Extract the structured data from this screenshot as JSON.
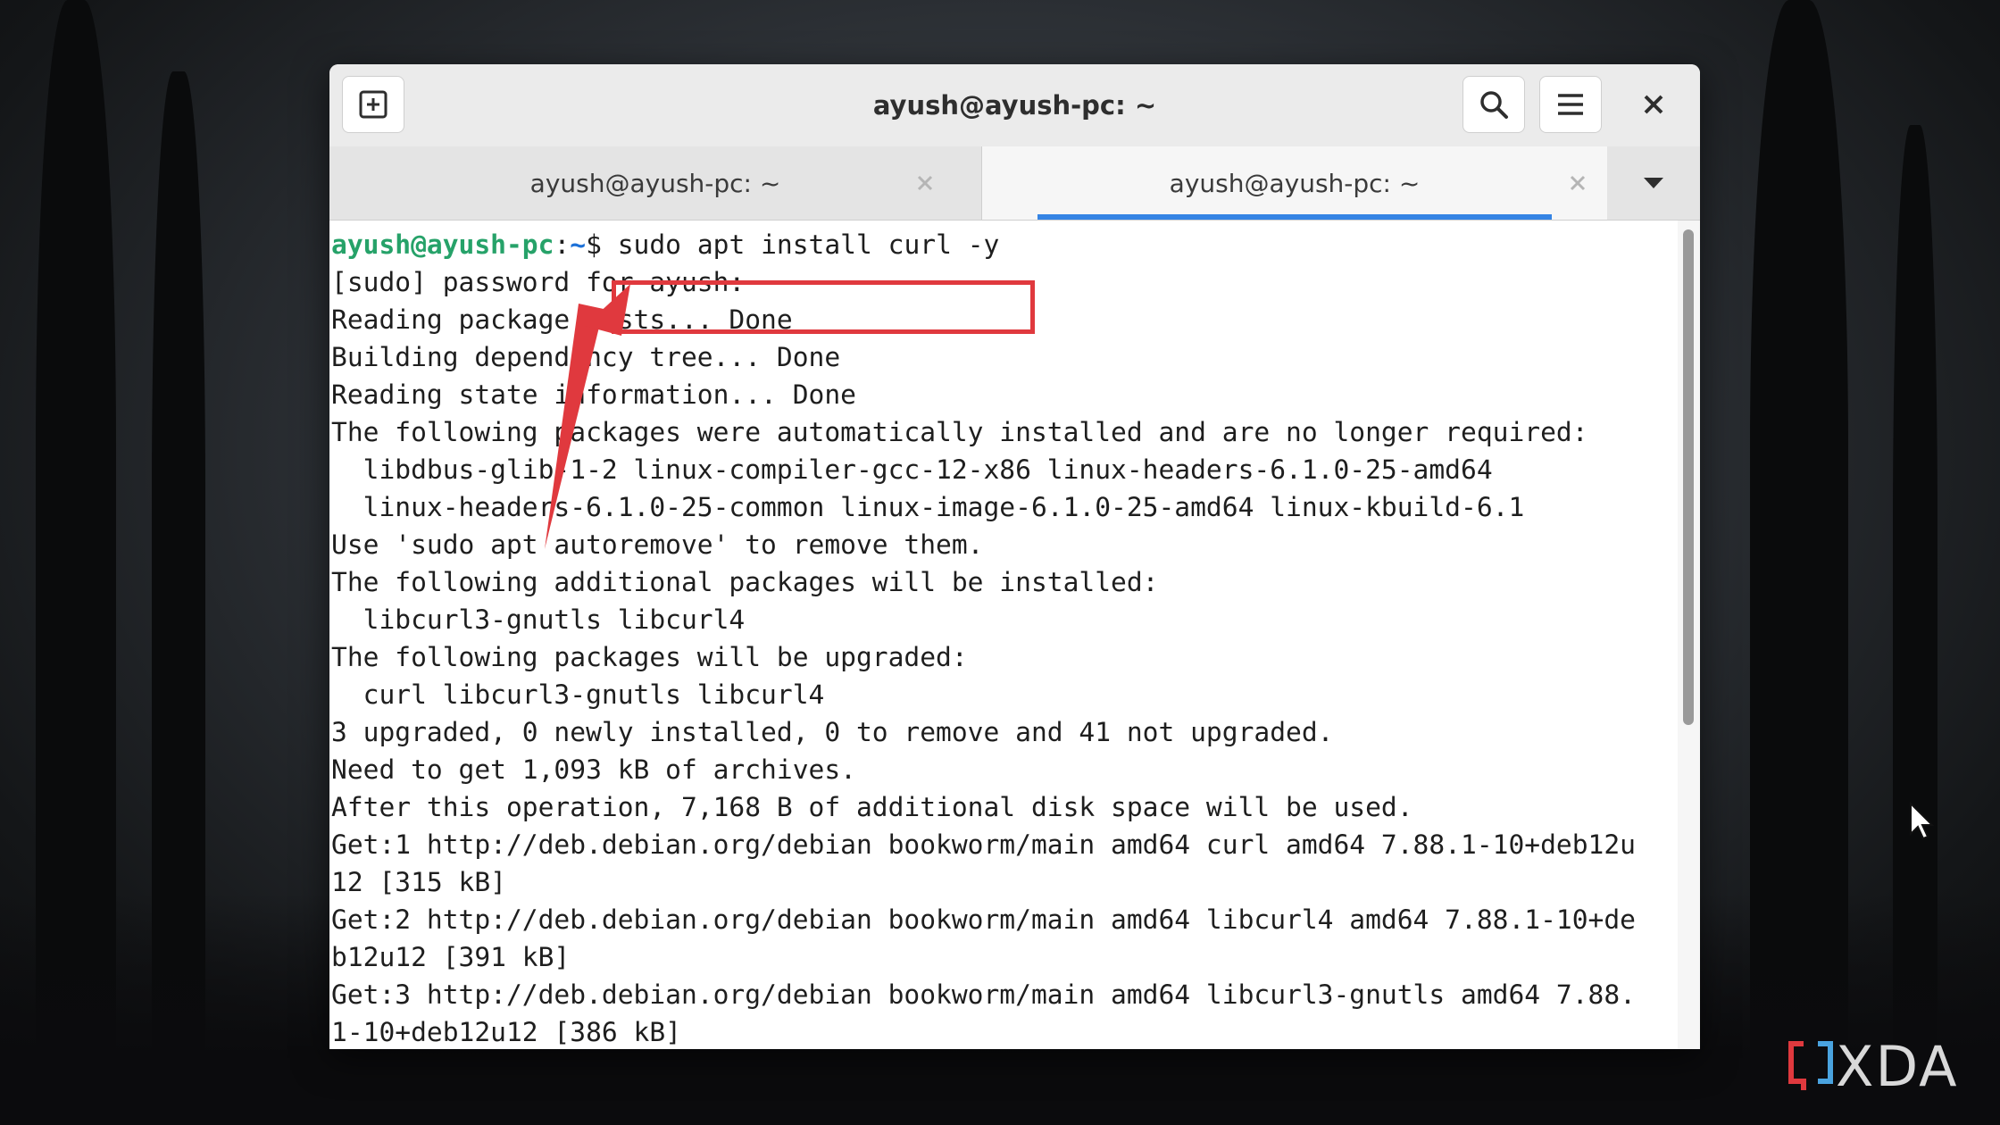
{
  "window": {
    "title": "ayush@ayush-pc: ~"
  },
  "tabs": [
    {
      "label": "ayush@ayush-pc: ~",
      "active": false
    },
    {
      "label": "ayush@ayush-pc: ~",
      "active": true
    }
  ],
  "terminal": {
    "prompt_user": "ayush@ayush-pc",
    "prompt_sep": ":",
    "prompt_path": "~",
    "prompt_symbol": "$ ",
    "command": "sudo apt install curl -y",
    "lines": [
      "[sudo] password for ayush:",
      "Reading package lists... Done",
      "Building dependency tree... Done",
      "Reading state information... Done",
      "The following packages were automatically installed and are no longer required:",
      "  libdbus-glib-1-2 linux-compiler-gcc-12-x86 linux-headers-6.1.0-25-amd64",
      "  linux-headers-6.1.0-25-common linux-image-6.1.0-25-amd64 linux-kbuild-6.1",
      "Use 'sudo apt autoremove' to remove them.",
      "The following additional packages will be installed:",
      "  libcurl3-gnutls libcurl4",
      "The following packages will be upgraded:",
      "  curl libcurl3-gnutls libcurl4",
      "3 upgraded, 0 newly installed, 0 to remove and 41 not upgraded.",
      "Need to get 1,093 kB of archives.",
      "After this operation, 7,168 B of additional disk space will be used.",
      "Get:1 http://deb.debian.org/debian bookworm/main amd64 curl amd64 7.88.1-10+deb12u",
      "12 [315 kB]",
      "Get:2 http://deb.debian.org/debian bookworm/main amd64 libcurl4 amd64 7.88.1-10+de",
      "b12u12 [391 kB]",
      "Get:3 http://deb.debian.org/debian bookworm/main amd64 libcurl3-gnutls amd64 7.88.",
      "1-10+deb12u12 [386 kB]"
    ]
  },
  "icons": {
    "new_tab": "new-tab-icon",
    "search": "search-icon",
    "menu": "hamburger-menu-icon",
    "close": "close-icon",
    "dropdown": "chevron-down-icon"
  },
  "colors": {
    "prompt_user": "#26a269",
    "prompt_path": "#1c71d8",
    "tab_indicator": "#3584e4",
    "annotation_red": "#e0393e"
  },
  "watermark": {
    "text": "XDA"
  }
}
